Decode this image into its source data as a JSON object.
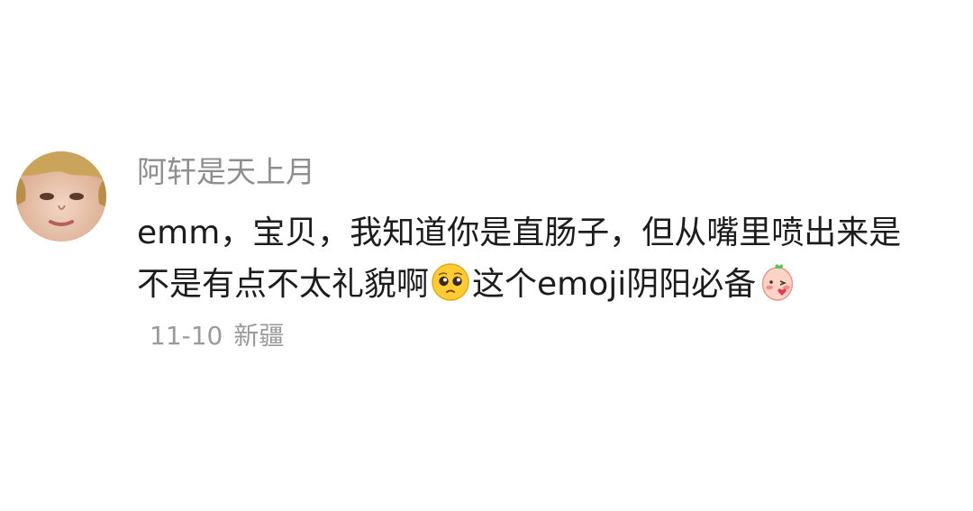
{
  "comment": {
    "username": "阿轩是天上月",
    "text_before_emoji": "emm，宝贝，我知道你是直肠子，但从嘴里喷出来是不是有点不太礼貌啊",
    "emoji_1": "pleading-face-emoji",
    "text_middle": "这个emoji阴阳必备",
    "emoji_2": "blushing-peach-sticker",
    "date": "11-10",
    "location": "新疆"
  }
}
